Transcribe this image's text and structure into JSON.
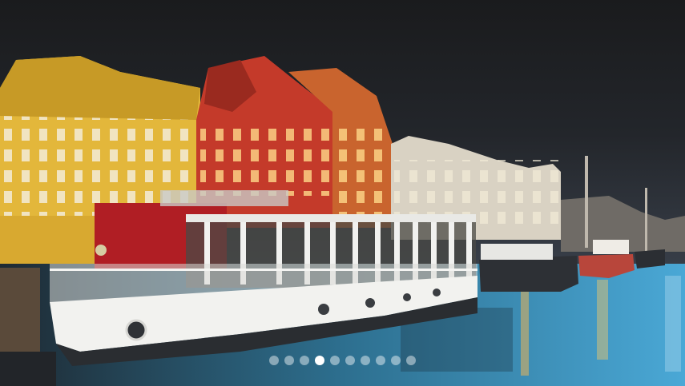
{
  "slider": {
    "dot_count": 10,
    "active_index": 3,
    "dot_active_color": "#ffffff",
    "dot_inactive_color": "#9aa3ad"
  },
  "scene": {
    "sky_top_color": "#1a1b1d",
    "sky_bottom_color": "#3b4350",
    "water_color": "#3a8fb8"
  }
}
